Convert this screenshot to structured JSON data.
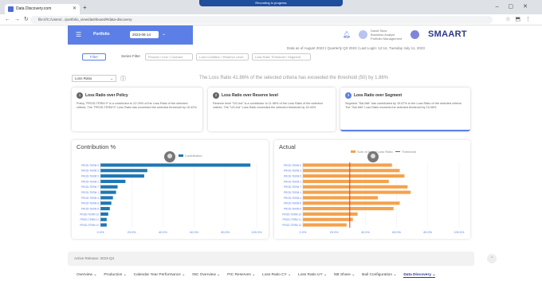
{
  "browser": {
    "tab_title": "Data Discovery.com",
    "url": "file:///C:/Users/.../portfolio_view/dashboard#/data-discovery",
    "recording_bar": "Recording in progress"
  },
  "header": {
    "portfolio_label": "Portfolio",
    "portfolio_value": "2023-06-14",
    "user_name": "David Stow",
    "user_role": "Business Analyst",
    "user_detail": "Portfolio Management",
    "brand": "SMAART"
  },
  "data_as_of": "Data as of August 2023 | Quarterly Q3 2023 | Last Login: 12:14, Tuesday July 11, 2023",
  "filters": {
    "filter_button": "Filter",
    "series_filter_label": "Series Filter",
    "input1_placeholder": "Product / Line / Contract",
    "input2_placeholder": "Loss Condition / Reserve Level",
    "input3_placeholder": "Loss Ratio Threshold / Segment"
  },
  "metric_select": "Loss Ratio",
  "alert_text": "The Loss Ratio 41.86% of the selected criteria has exceeded the threshold (50) by 1.86%",
  "cards": [
    {
      "number": "1",
      "title": "Loss Ratio over Policy",
      "text": "Policy \"PROD-TERM 9\" is a contributor to 22.29% of the Loss Ratio of the selected criteria. The \"PROD-TERM 9\" Loss Ratio has exceeded the selected threshold by 15.42%"
    },
    {
      "number": "2",
      "title": "Loss Ratio over Reserve level",
      "text": "Reserve level \"US-Ind\" is a contributor to 11.98% of the Loss Ratio of the selected criteria. The \"US-Ind\" Loss Ratio exceeded the selected threshold by 15.40%"
    },
    {
      "number": "3",
      "title": "Loss Ratio over Segment",
      "text": "Segment \"Sal-Mkt\" has contributed by 19.67% to the Loss Ratio of the selected criteria. The \"Sal-Mkt\" Loss Ratio exceeds the selected threshold by 15.08%"
    }
  ],
  "chart_contribution": {
    "title": "Contribution %",
    "legend": "Contribution"
  },
  "chart_actual": {
    "title": "Actual",
    "legend_a": "Sum of Actual Loss Ratio",
    "legend_b": "Threshold"
  },
  "chart_data": [
    {
      "type": "bar",
      "orientation": "horizontal",
      "title": "Contribution %",
      "categories": [
        "PROD-TERM 9",
        "PROD-TERM 3",
        "PROD-TERM 5",
        "PROD-TERM 2",
        "PROD-TERM 7",
        "PROD-TERM 1",
        "PROD-TERM 4",
        "PROD-TERM 8",
        "PROD-TERM 6",
        "PROD-TERM 10",
        "PROD-TERM 11",
        "PROD-TERM 12"
      ],
      "values": [
        96,
        30,
        28,
        16,
        11,
        10,
        8,
        7,
        6,
        5,
        4,
        4
      ],
      "xticks": [
        "0.0%",
        "20.0%",
        "40.0%",
        "60.0%",
        "80.0%",
        "100.0%"
      ],
      "xlim": [
        0,
        100
      ],
      "color": "#1f77b4"
    },
    {
      "type": "bar",
      "orientation": "horizontal",
      "title": "Actual",
      "categories": [
        "PROD-TERM 9",
        "PROD-TERM 3",
        "PROD-TERM 5",
        "PROD-TERM 2",
        "PROD-TERM 7",
        "PROD-TERM 1",
        "PROD-TERM 4",
        "PROD-TERM 8",
        "PROD-TERM 6",
        "PROD-TERM 10",
        "PROD-TERM 11",
        "PROD-TERM 12"
      ],
      "series": [
        {
          "name": "Sum of Actual Loss Ratio",
          "values": [
            57,
            62,
            65,
            55,
            67,
            69,
            48,
            62,
            58,
            35,
            32,
            28
          ]
        }
      ],
      "threshold": 30,
      "xticks": [
        "0.0%",
        "20.0%",
        "40.0%",
        "60.0%",
        "80.0%",
        "100.0%"
      ],
      "xlim": [
        0,
        100
      ],
      "bar_color": "#f4a24c",
      "threshold_color": "#e0352b"
    }
  ],
  "footer": {
    "active_label": "Active Release: 2023-Q3",
    "tabs": [
      "Overview",
      "Production",
      "Calendar Year Performance",
      "INC Overview",
      "PIC Reserves",
      "Loss Ratio CY",
      "Loss Ratio UY",
      "NB Share",
      "Bail Configuration",
      "Data Discovery"
    ],
    "active_tab": "Data Discovery"
  }
}
